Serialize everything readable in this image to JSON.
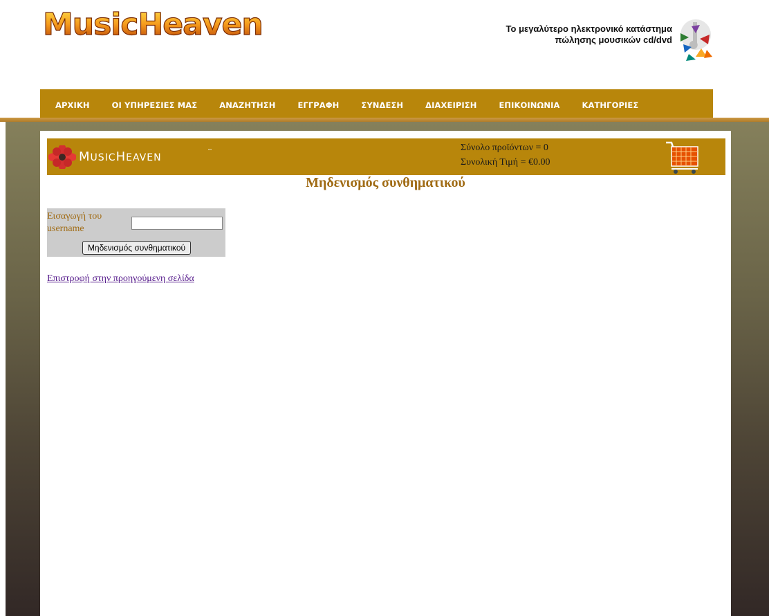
{
  "header": {
    "logo_text": "MusicHeaven",
    "tagline_line1": "Το μεγαλύτερο ηλεκτρονικό κατάστημα",
    "tagline_line2": "πώλησης μουσικών cd/dvd"
  },
  "nav": {
    "items": [
      {
        "label": "ΑΡΧΙΚΗ"
      },
      {
        "label": "ΟΙ ΥΠΗΡΕΣΙΕΣ ΜΑΣ"
      },
      {
        "label": "ΑΝΑΖΗΤΗΣΗ"
      },
      {
        "label": "ΕΓΓΡΑΦΗ"
      },
      {
        "label": "ΣΥΝΔΕΣΗ"
      },
      {
        "label": "ΔΙΑΧΕΙΡΙΣΗ"
      },
      {
        "label": "ΕΠΙΚΟΙΝΩΝΙΑ"
      },
      {
        "label": "ΚΑΤΗΓΟΡΙΕΣ"
      }
    ]
  },
  "cart": {
    "logo_m": "M",
    "logo_rest": "USIC",
    "logo_h": "H",
    "logo_rest2": "EAVEN",
    "logo_tm": "™",
    "items_total": "Σύνολο προϊόντων = 0",
    "price_total": "Συνολική Τιμή = €0.00",
    "icon": "shopping-cart-icon"
  },
  "reset": {
    "title": "Μηδενισμός συνθηματικού",
    "username_label": "Εισαγωγή του username",
    "username_value": "",
    "button_label": "Μηδενισμός συνθηματικού"
  },
  "back_link": "Επιστροφή στην προηγούμενη σελίδα",
  "colors": {
    "accent": "#b8860b",
    "title": "#a06b14",
    "form_bg": "#cccccc",
    "link": "#551a8b"
  }
}
